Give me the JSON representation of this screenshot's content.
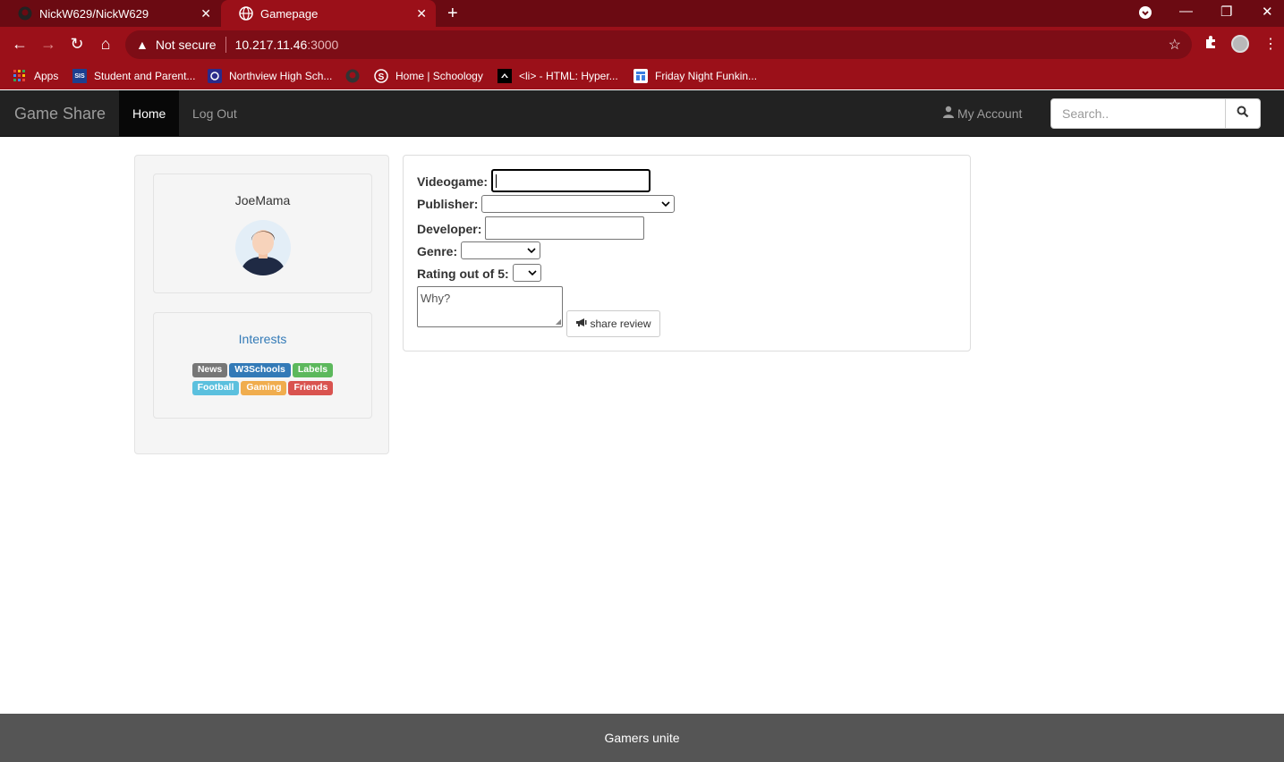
{
  "browser": {
    "tabs": [
      {
        "title": "NickW629/NickW629",
        "icon": "github-icon"
      },
      {
        "title": "Gamepage",
        "icon": "globe-icon"
      }
    ],
    "security_label": "Not secure",
    "url_host": "10.217.11.46",
    "url_port": ":3000",
    "bookmarks": [
      {
        "label": "Apps",
        "icon": "apps-grid-icon"
      },
      {
        "label": "Student and Parent...",
        "icon": "sis-icon",
        "icon_text": "SIS"
      },
      {
        "label": "Northview High Sch...",
        "icon": "school-icon"
      },
      {
        "label": "",
        "icon": "github-icon"
      },
      {
        "label": "Home | Schoology",
        "icon": "schoology-icon"
      },
      {
        "label": "<li> - HTML: Hyper...",
        "icon": "mdn-icon"
      },
      {
        "label": "Friday Night Funkin...",
        "icon": "game-icon"
      }
    ],
    "colors": {
      "tabstrip": "#6b0a12",
      "toolbar": "#9b1019"
    }
  },
  "site": {
    "brand": "Game Share",
    "nav": {
      "home": "Home",
      "logout": "Log Out",
      "account": "My Account"
    },
    "search": {
      "placeholder": "Search.."
    }
  },
  "profile": {
    "username": "JoeMama",
    "interests_title": "Interests",
    "interests": [
      {
        "label": "News",
        "style": "default"
      },
      {
        "label": "W3Schools",
        "style": "primary"
      },
      {
        "label": "Labels",
        "style": "success"
      },
      {
        "label": "Football",
        "style": "info"
      },
      {
        "label": "Gaming",
        "style": "warning"
      },
      {
        "label": "Friends",
        "style": "danger"
      }
    ]
  },
  "form": {
    "videogame_label": "Videogame:",
    "publisher_label": "Publisher:",
    "developer_label": "Developer:",
    "genre_label": "Genre:",
    "rating_label": "Rating out of 5:",
    "why_placeholder": "Why?",
    "share_button": "share review"
  },
  "footer": {
    "text": "Gamers unite"
  }
}
